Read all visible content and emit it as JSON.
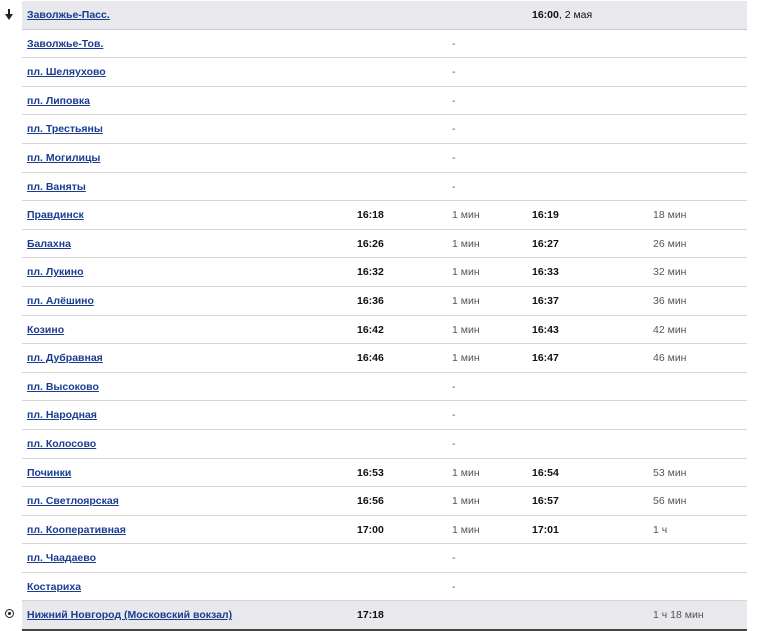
{
  "start_icon": "arrow-down-icon",
  "end_icon": "circle-dot-icon",
  "rows": [
    {
      "station": "Заволжье-Пасс.",
      "arrival": "",
      "stop": "",
      "departure": "16:00",
      "departure_suffix": ", 2 мая",
      "travel": "",
      "highlight": true,
      "marker": "start"
    },
    {
      "station": "Заволжье-Тов.",
      "arrival": "",
      "stop": "-",
      "departure": "",
      "departure_suffix": "",
      "travel": ""
    },
    {
      "station": "пл. Шеляухово",
      "arrival": "",
      "stop": "-",
      "departure": "",
      "departure_suffix": "",
      "travel": ""
    },
    {
      "station": "пл. Липовка",
      "arrival": "",
      "stop": "-",
      "departure": "",
      "departure_suffix": "",
      "travel": ""
    },
    {
      "station": "пл. Трестьяны",
      "arrival": "",
      "stop": "-",
      "departure": "",
      "departure_suffix": "",
      "travel": ""
    },
    {
      "station": "пл. Могилицы",
      "arrival": "",
      "stop": "-",
      "departure": "",
      "departure_suffix": "",
      "travel": ""
    },
    {
      "station": "пл. Ваняты",
      "arrival": "",
      "stop": "-",
      "departure": "",
      "departure_suffix": "",
      "travel": ""
    },
    {
      "station": "Правдинск",
      "arrival": "16:18",
      "stop": "1 мин",
      "departure": "16:19",
      "departure_suffix": "",
      "travel": "18 мин"
    },
    {
      "station": "Балахна",
      "arrival": "16:26",
      "stop": "1 мин",
      "departure": "16:27",
      "departure_suffix": "",
      "travel": "26 мин"
    },
    {
      "station": "пл. Лукино",
      "arrival": "16:32",
      "stop": "1 мин",
      "departure": "16:33",
      "departure_suffix": "",
      "travel": "32 мин"
    },
    {
      "station": "пл. Алёшино",
      "arrival": "16:36",
      "stop": "1 мин",
      "departure": "16:37",
      "departure_suffix": "",
      "travel": "36 мин"
    },
    {
      "station": "Козино",
      "arrival": "16:42",
      "stop": "1 мин",
      "departure": "16:43",
      "departure_suffix": "",
      "travel": "42 мин"
    },
    {
      "station": "пл. Дубравная",
      "arrival": "16:46",
      "stop": "1 мин",
      "departure": "16:47",
      "departure_suffix": "",
      "travel": "46 мин"
    },
    {
      "station": "пл. Высоково",
      "arrival": "",
      "stop": "-",
      "departure": "",
      "departure_suffix": "",
      "travel": ""
    },
    {
      "station": "пл. Народная",
      "arrival": "",
      "stop": "-",
      "departure": "",
      "departure_suffix": "",
      "travel": ""
    },
    {
      "station": "пл. Колосово",
      "arrival": "",
      "stop": "-",
      "departure": "",
      "departure_suffix": "",
      "travel": ""
    },
    {
      "station": "Починки",
      "arrival": "16:53",
      "stop": "1 мин",
      "departure": "16:54",
      "departure_suffix": "",
      "travel": "53 мин"
    },
    {
      "station": "пл. Светлоярская",
      "arrival": "16:56",
      "stop": "1 мин",
      "departure": "16:57",
      "departure_suffix": "",
      "travel": "56 мин"
    },
    {
      "station": "пл. Кооперативная",
      "arrival": "17:00",
      "stop": "1 мин",
      "departure": "17:01",
      "departure_suffix": "",
      "travel": "1 ч"
    },
    {
      "station": "пл. Чаадаево",
      "arrival": "",
      "stop": "-",
      "departure": "",
      "departure_suffix": "",
      "travel": ""
    },
    {
      "station": "Костариха",
      "arrival": "",
      "stop": "-",
      "departure": "",
      "departure_suffix": "",
      "travel": ""
    },
    {
      "station": "Нижний Новгород (Московский вокзал)",
      "arrival": "17:18",
      "stop": "",
      "departure": "",
      "departure_suffix": "",
      "travel": "1 ч 18 мин",
      "highlight": true,
      "marker": "end"
    }
  ]
}
